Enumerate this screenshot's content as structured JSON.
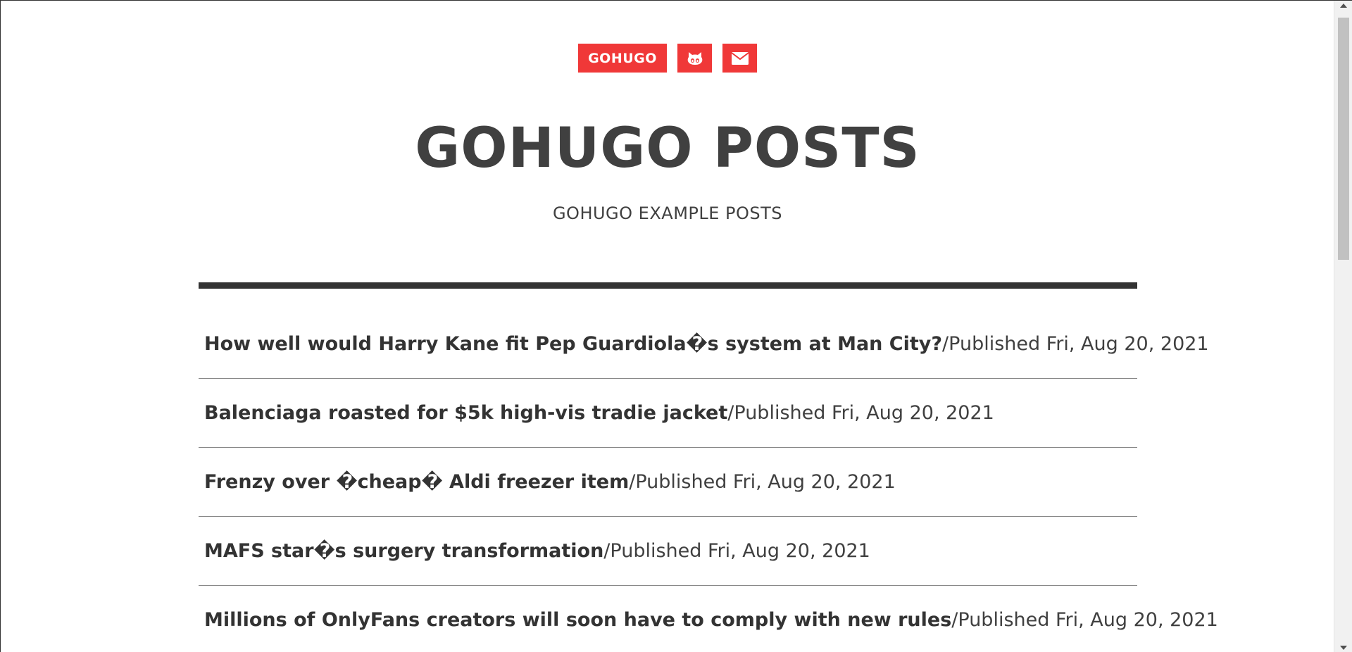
{
  "nav": {
    "home_label": "GOHUGO",
    "github_icon": "github-icon",
    "email_icon": "envelope-icon"
  },
  "header": {
    "title": "GOHUGO POSTS",
    "subtitle": "GOHUGO EXAMPLE POSTS"
  },
  "posts": [
    {
      "title": "How well would Harry Kane fit Pep Guardiola�s system at Man City?",
      "separator": " / ",
      "meta": "Published Fri, Aug 20, 2021"
    },
    {
      "title": "Balenciaga roasted for $5k high-vis tradie jacket",
      "separator": " / ",
      "meta": "Published Fri, Aug 20, 2021"
    },
    {
      "title": "Frenzy over �cheap� Aldi freezer item",
      "separator": " / ",
      "meta": "Published Fri, Aug 20, 2021"
    },
    {
      "title": "MAFS star�s surgery transformation",
      "separator": " / ",
      "meta": "Published Fri, Aug 20, 2021"
    },
    {
      "title": "Millions of OnlyFans creators will soon have to comply with new rules",
      "separator": " / ",
      "meta": "Published Fri, Aug 20, 2021"
    }
  ],
  "colors": {
    "accent": "#f03838",
    "text": "#404040",
    "rule": "#333333"
  }
}
